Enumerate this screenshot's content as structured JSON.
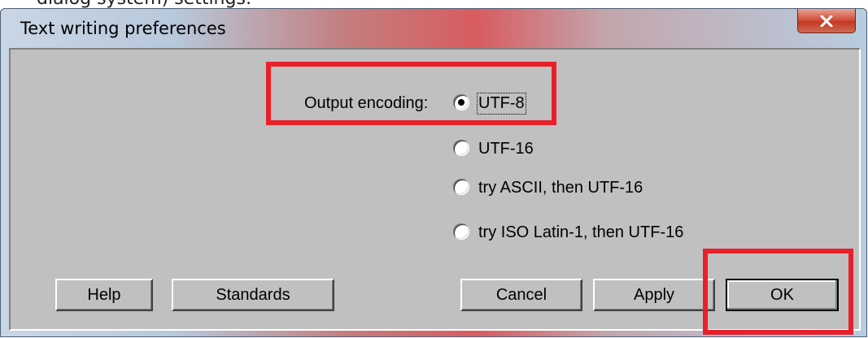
{
  "top_strip": {
    "text": "dialog system) settings:"
  },
  "window": {
    "title": "Text writing preferences",
    "close_symbol": "X",
    "close_icon": "close-icon"
  },
  "encoding": {
    "label": "Output encoding:",
    "selected": "UTF-8",
    "options": [
      {
        "label": "UTF-8",
        "checked": true
      },
      {
        "label": "UTF-16",
        "checked": false
      },
      {
        "label": "try ASCII, then UTF-16",
        "checked": false
      },
      {
        "label": "try ISO Latin-1, then UTF-16",
        "checked": false
      }
    ]
  },
  "buttons": {
    "help": "Help",
    "standards": "Standards",
    "cancel": "Cancel",
    "apply": "Apply",
    "ok": "OK"
  },
  "colors": {
    "dialog_face": "#c0c0c0",
    "highlight": "#e8202a",
    "close_button": "#c43a22"
  }
}
